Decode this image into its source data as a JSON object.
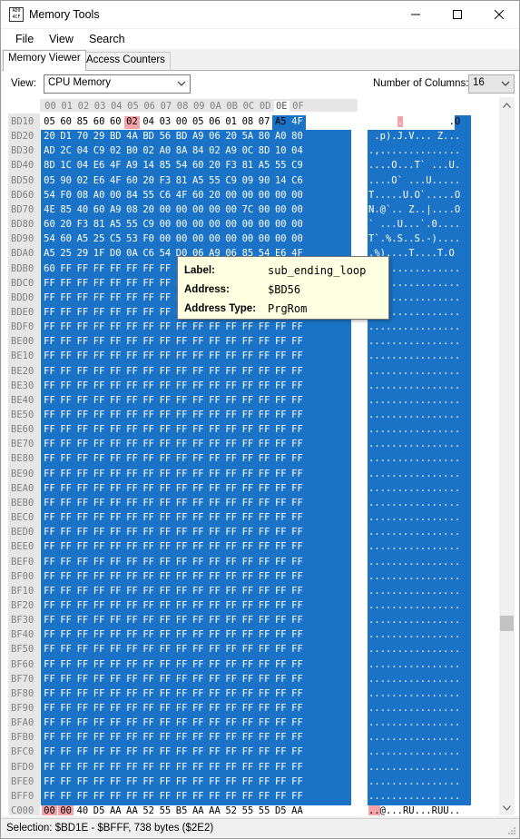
{
  "window": {
    "title": "Memory Tools",
    "icon_text": "AD9 4CF"
  },
  "menu": [
    "File",
    "View",
    "Search"
  ],
  "tabs": [
    {
      "label": "Memory Viewer",
      "active": true
    },
    {
      "label": "Access Counters",
      "active": false
    }
  ],
  "toolbar": {
    "view_label": "View:",
    "view_value": "CPU Memory",
    "columns_label": "Number of Columns:",
    "columns_value": "16"
  },
  "hex": {
    "column_headers": [
      "00",
      "01",
      "02",
      "03",
      "04",
      "05",
      "06",
      "07",
      "08",
      "09",
      "0A",
      "0B",
      "0C",
      "0D",
      "0E",
      "0F"
    ],
    "rows": [
      {
        "addr": "BD10",
        "bytes": [
          "05",
          "60",
          "85",
          "60",
          "60",
          "02",
          "04",
          "03",
          "00",
          "05",
          "06",
          "01",
          "08",
          "07",
          "A5",
          "4F"
        ],
        "ascii": ".`.``..........O"
      },
      {
        "addr": "BD20",
        "bytes": [
          "20",
          "D1",
          "70",
          "29",
          "BD",
          "4A",
          "BD",
          "56",
          "BD",
          "A9",
          "06",
          "20",
          "5A",
          "80",
          "A0",
          "80"
        ],
        "ascii": " .p).J.V... Z..."
      },
      {
        "addr": "BD30",
        "bytes": [
          "AD",
          "2C",
          "04",
          "C9",
          "02",
          "B0",
          "02",
          "A0",
          "8A",
          "84",
          "02",
          "A9",
          "0C",
          "8D",
          "10",
          "04"
        ],
        "ascii": ".,.............."
      },
      {
        "addr": "BD40",
        "bytes": [
          "8D",
          "1C",
          "04",
          "E6",
          "4F",
          "A9",
          "14",
          "85",
          "54",
          "60",
          "20",
          "F3",
          "81",
          "A5",
          "55",
          "C9"
        ],
        "ascii": "....O...T` ...U."
      },
      {
        "addr": "BD50",
        "bytes": [
          "05",
          "90",
          "02",
          "E6",
          "4F",
          "60",
          "20",
          "F3",
          "81",
          "A5",
          "55",
          "C9",
          "09",
          "90",
          "14",
          "C6"
        ],
        "ascii": "....O` ...U....."
      },
      {
        "addr": "BD60",
        "bytes": [
          "54",
          "F0",
          "08",
          "A0",
          "00",
          "84",
          "55",
          "C6",
          "4F",
          "60",
          "20",
          "00",
          "00",
          "00",
          "00",
          "00"
        ],
        "ascii": "T.....U.O`.....O"
      },
      {
        "addr": "BD70",
        "bytes": [
          "4E",
          "85",
          "40",
          "60",
          "A9",
          "08",
          "20",
          "00",
          "00",
          "00",
          "00",
          "00",
          "7C",
          "00",
          "00",
          "00"
        ],
        "ascii": "N.@`.. Z..|....O"
      },
      {
        "addr": "BD80",
        "bytes": [
          "60",
          "20",
          "F3",
          "81",
          "A5",
          "55",
          "C9",
          "00",
          "00",
          "00",
          "00",
          "00",
          "00",
          "00",
          "00",
          "00"
        ],
        "ascii": "` ...U...`.0...."
      },
      {
        "addr": "BD90",
        "bytes": [
          "54",
          "60",
          "A5",
          "25",
          "C5",
          "53",
          "F0",
          "00",
          "00",
          "00",
          "00",
          "00",
          "00",
          "00",
          "00",
          "00"
        ],
        "ascii": "T`.%.S..S.-)...."
      },
      {
        "addr": "BDA0",
        "bytes": [
          "A5",
          "25",
          "29",
          "1F",
          "D0",
          "0A",
          "C6",
          "54",
          "D0",
          "06",
          "A9",
          "06",
          "85",
          "54",
          "E6",
          "4F"
        ],
        "ascii": ".%)....T....T.O"
      },
      {
        "addr": "BDB0",
        "bytes": [
          "60",
          "FF",
          "FF",
          "FF",
          "FF",
          "FF",
          "FF",
          "FF",
          "FF",
          "FF",
          "FF",
          "FF",
          "FF",
          "FF",
          "FF",
          "FF"
        ],
        "ascii": "`..............."
      },
      {
        "addr": "BDC0",
        "fill": "FF"
      },
      {
        "addr": "BDD0",
        "fill": "FF"
      },
      {
        "addr": "BDE0",
        "fill": "FF"
      },
      {
        "addr": "BDF0",
        "fill": "FF"
      },
      {
        "addr": "BE00",
        "fill": "FF"
      },
      {
        "addr": "BE10",
        "fill": "FF"
      },
      {
        "addr": "BE20",
        "fill": "FF"
      },
      {
        "addr": "BE30",
        "fill": "FF"
      },
      {
        "addr": "BE40",
        "fill": "FF"
      },
      {
        "addr": "BE50",
        "fill": "FF"
      },
      {
        "addr": "BE60",
        "fill": "FF"
      },
      {
        "addr": "BE70",
        "fill": "FF"
      },
      {
        "addr": "BE80",
        "fill": "FF"
      },
      {
        "addr": "BE90",
        "fill": "FF"
      },
      {
        "addr": "BEA0",
        "fill": "FF"
      },
      {
        "addr": "BEB0",
        "fill": "FF"
      },
      {
        "addr": "BEC0",
        "fill": "FF"
      },
      {
        "addr": "BED0",
        "fill": "FF"
      },
      {
        "addr": "BEE0",
        "fill": "FF"
      },
      {
        "addr": "BEF0",
        "fill": "FF"
      },
      {
        "addr": "BF00",
        "fill": "FF"
      },
      {
        "addr": "BF10",
        "fill": "FF"
      },
      {
        "addr": "BF20",
        "fill": "FF"
      },
      {
        "addr": "BF30",
        "fill": "FF"
      },
      {
        "addr": "BF40",
        "fill": "FF"
      },
      {
        "addr": "BF50",
        "fill": "FF"
      },
      {
        "addr": "BF60",
        "fill": "FF"
      },
      {
        "addr": "BF70",
        "fill": "FF"
      },
      {
        "addr": "BF80",
        "fill": "FF"
      },
      {
        "addr": "BF90",
        "fill": "FF"
      },
      {
        "addr": "BFA0",
        "fill": "FF"
      },
      {
        "addr": "BFB0",
        "fill": "FF"
      },
      {
        "addr": "BFC0",
        "fill": "FF"
      },
      {
        "addr": "BFD0",
        "fill": "FF"
      },
      {
        "addr": "BFE0",
        "fill": "FF"
      },
      {
        "addr": "BFF0",
        "fill": "FF"
      },
      {
        "addr": "C000",
        "bytes": [
          "00",
          "00",
          "40",
          "D5",
          "AA",
          "AA",
          "52",
          "55",
          "B5",
          "AA",
          "AA",
          "52",
          "55",
          "55",
          "D5",
          "AA"
        ],
        "ascii": "..@...RU...RUU.."
      }
    ],
    "selection_color": "#1a73c6",
    "highlight_color": "#f4a3a8"
  },
  "tooltip": {
    "label_key": "Label:",
    "label_value": "sub_ending_loop",
    "address_key": "Address:",
    "address_value": "$BD56",
    "type_key": "Address Type:",
    "type_value": "PrgRom"
  },
  "status": "Selection: $BD1E - $BFFF, 738 bytes ($2E2)"
}
